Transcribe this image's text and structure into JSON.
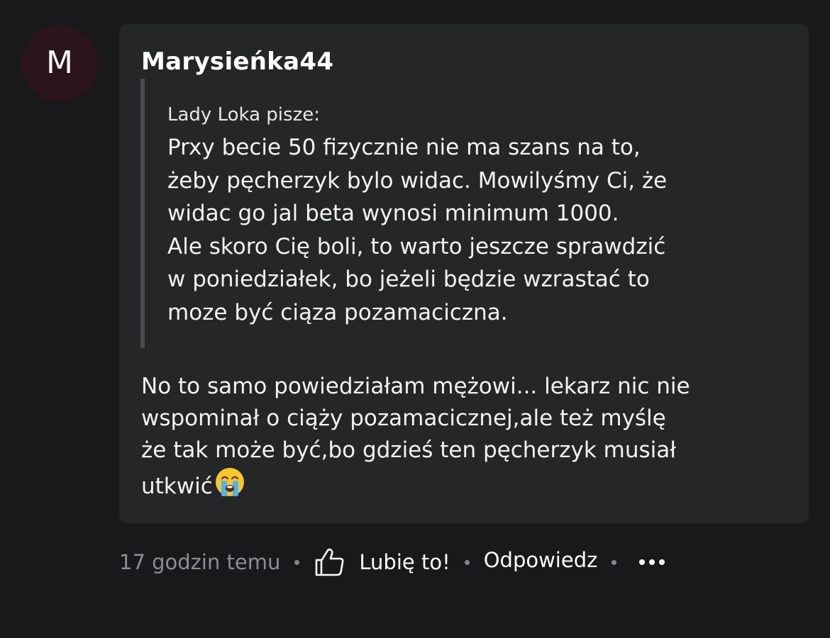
{
  "comment": {
    "avatar_initial": "M",
    "author": "Marysieńka44",
    "quote": {
      "source": "Lady Loka pisze:",
      "lines": [
        "Prxy becie 50 fizycznie nie ma szans na to,",
        "żeby pęcherzyk bylo widac. Mowilyśmy Ci, że",
        "widac go jal beta wynosi minimum 1000.",
        "Ale skoro Cię boli, to warto jeszcze sprawdzić",
        "w poniedziałek, bo jeżeli będzie wzrastać to",
        "moze być ciąza pozamaciczna."
      ]
    },
    "body_lines": [
      "No to samo powiedziałam mężowi... lekarz nic nie",
      "wspominał o ciąży pozamacicznej,ale też myślę",
      "że tak może być,bo gdzieś ten pęcherzyk musiał",
      "utkwić"
    ],
    "trailing_emoji": "loudly-crying-face-emoji"
  },
  "actions": {
    "time": "17 godzin temu",
    "like_label": "Lubię to!",
    "reply_label": "Odpowiedz",
    "like_icon": "thumbs-up-icon",
    "more_icon": "more-options-icon"
  },
  "colors": {
    "background": "#19191b",
    "bubble": "#252628",
    "avatar_bg": "#2b141b",
    "quote_bar": "#48494c",
    "muted_text": "#8d8e93"
  }
}
